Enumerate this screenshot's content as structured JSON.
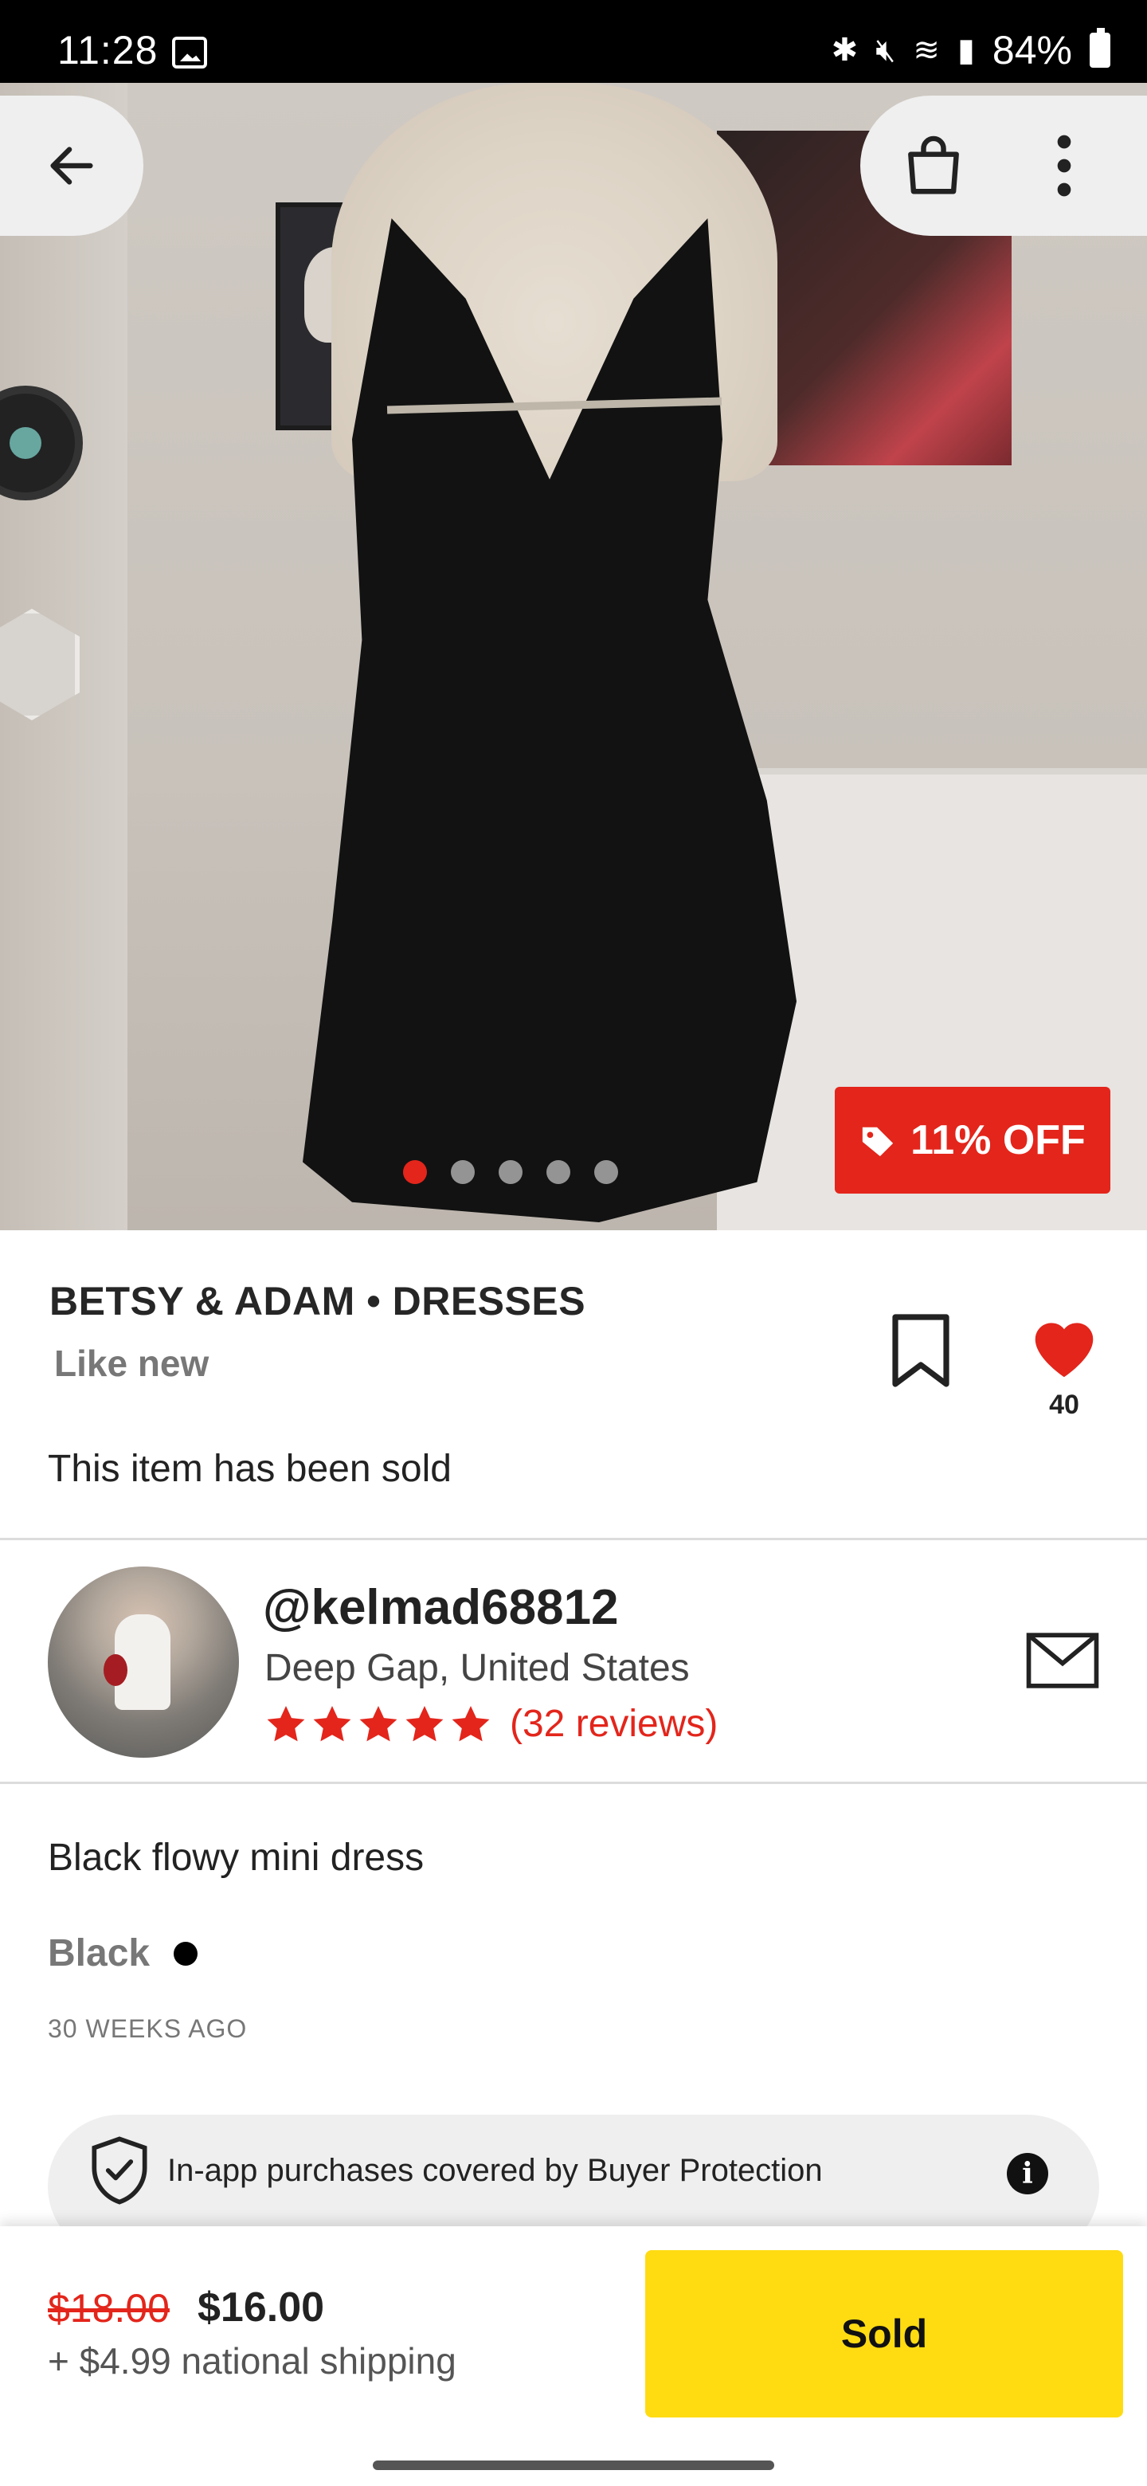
{
  "status_bar": {
    "time": "11:28",
    "battery": "84%",
    "icons": [
      "gallery-icon",
      "bluetooth-icon",
      "mute-icon",
      "wifi-icon",
      "signal-icon",
      "battery-icon"
    ]
  },
  "hero": {
    "carousel": {
      "total": 5,
      "active_index": 0
    },
    "discount_label": "11% OFF"
  },
  "product": {
    "brand": "BETSY & ADAM",
    "separator": " • ",
    "category": "DRESSES",
    "condition": "Like new",
    "like_count": "40",
    "sold_message": "This item has been sold",
    "description": "Black flowy mini dress",
    "color": "Black",
    "posted": "30 WEEKS AGO"
  },
  "seller": {
    "username": "@kelmad68812",
    "location": "Deep Gap, United States",
    "rating": 5,
    "reviews": "(32 reviews)"
  },
  "protection": {
    "text": "In-app purchases covered by Buyer Protection"
  },
  "purchase": {
    "original_price": "$18.00",
    "price": "$16.00",
    "shipping": "+ $4.99 national shipping",
    "button_label": "Sold"
  },
  "colors": {
    "accent_red": "#e3251b",
    "sold_yellow": "#ffdc12",
    "pill_gray": "#efefef"
  }
}
